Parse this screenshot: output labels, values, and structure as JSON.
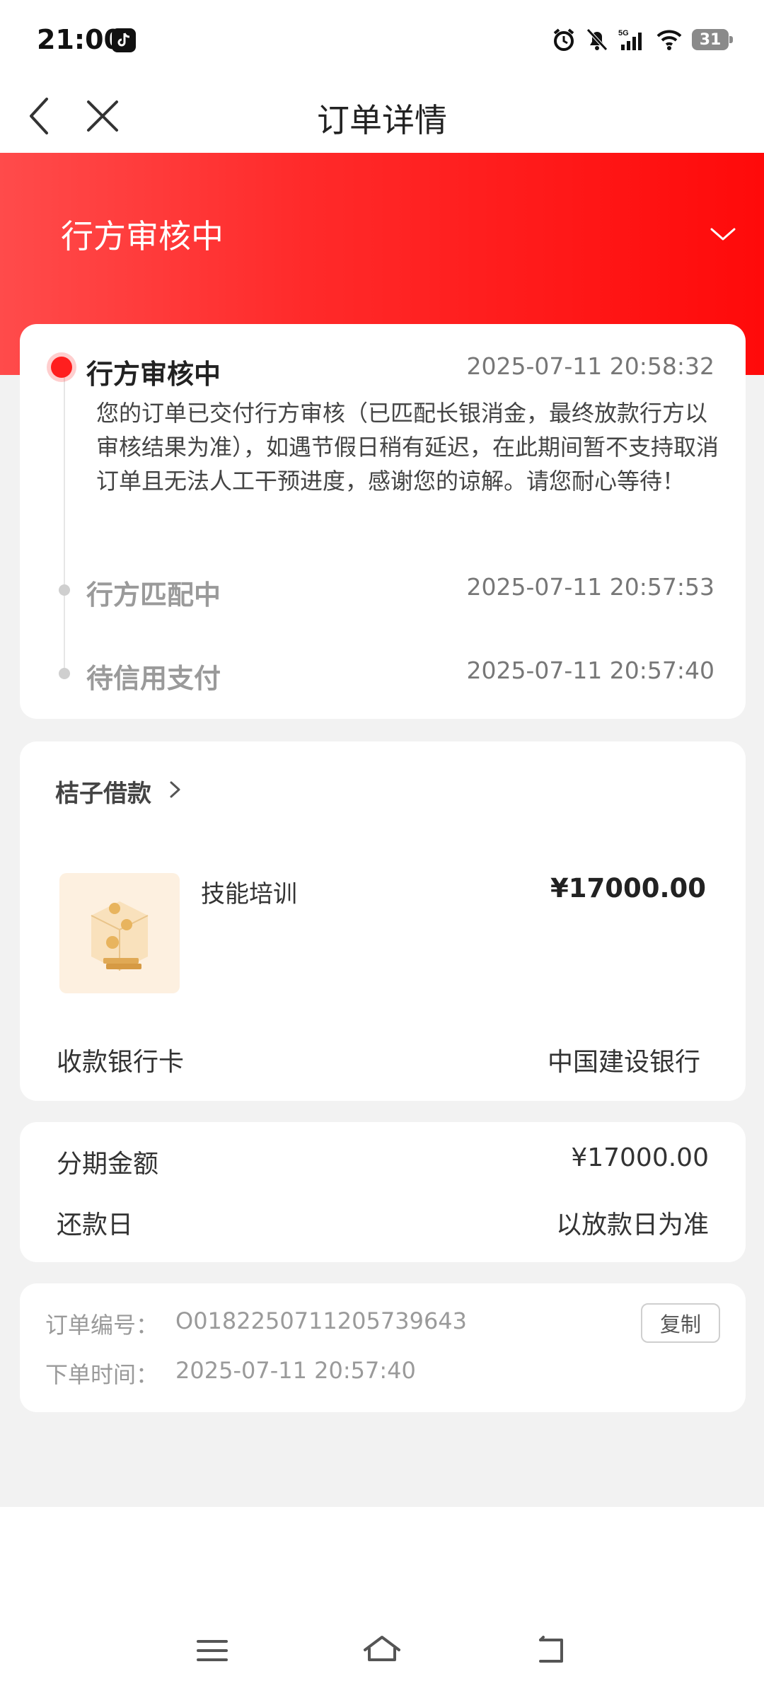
{
  "status_bar": {
    "time": "21:00",
    "network": "5G",
    "battery": "31",
    "icons": [
      "tiktok-icon",
      "alarm-icon",
      "mute-bell-icon",
      "signal-icon",
      "wifi-icon",
      "battery-icon"
    ]
  },
  "nav": {
    "title": "订单详情",
    "back_icon": "chevron-left-icon",
    "close_icon": "close-icon"
  },
  "status_banner": {
    "title": "行方审核中",
    "expand_icon": "chevron-down-icon"
  },
  "timeline": [
    {
      "title": "行方审核中",
      "time": "2025-07-11 20:58:32",
      "description": "您的订单已交付行方审核（已匹配长银消金，最终放款行方以审核结果为准），如遇节假日稍有延迟，在此期间暂不支持取消订单且无法人工干预进度，感谢您的谅解。请您耐心等待！",
      "active": true
    },
    {
      "title": "行方匹配中",
      "time": "2025-07-11 20:57:53",
      "active": false
    },
    {
      "title": "待信用支付",
      "time": "2025-07-11 20:57:40",
      "active": false
    }
  ],
  "merchant": {
    "name": "桔子借款",
    "product_name": "技能培训",
    "product_price": "¥17000.00",
    "bank_label": "收款银行卡",
    "bank_value": "中国建设银行"
  },
  "installment": {
    "amount_label": "分期金额",
    "amount_value": "¥17000.00",
    "repay_label": "还款日",
    "repay_value": "以放款日为准"
  },
  "order_info": {
    "order_no_label": "订单编号：",
    "order_no": "O0182250711205739643",
    "copy_label": "复制",
    "order_time_label": "下单时间：",
    "order_time": "2025-07-11 20:57:40"
  },
  "system_nav": {
    "icons": [
      "menu-icon",
      "home-icon",
      "back-icon"
    ]
  },
  "colors": {
    "accent_red": "#ff1f1f",
    "page_background": "#f2f2f2"
  }
}
